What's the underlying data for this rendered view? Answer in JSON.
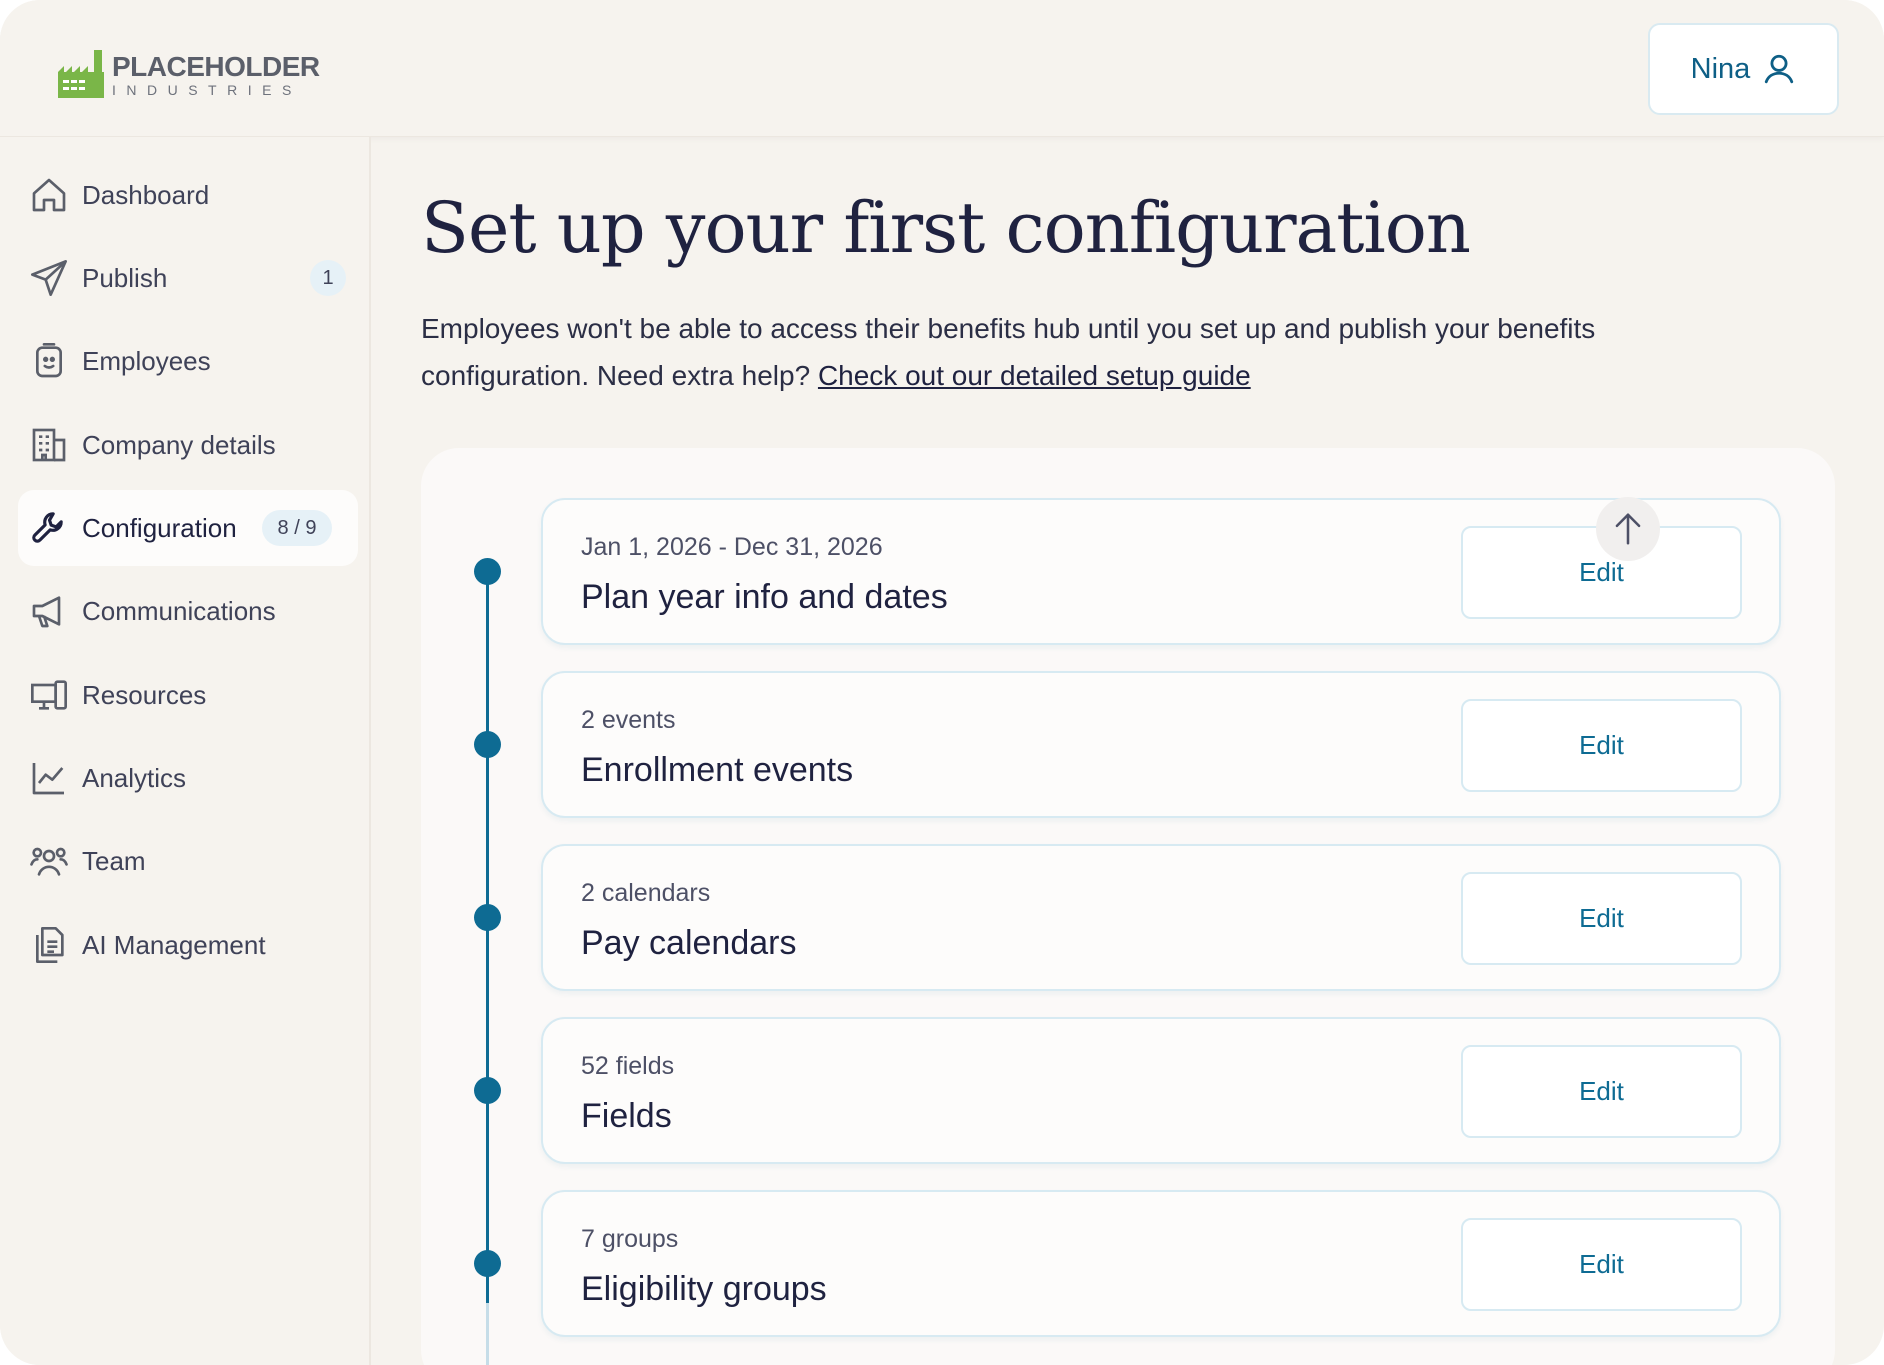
{
  "brand": {
    "name_line1": "PLACEHOLDER",
    "name_line2": "INDUSTRIES",
    "logo_color": "#7ab648"
  },
  "user": {
    "name": "Nina"
  },
  "sidebar": {
    "items": [
      {
        "label": "Dashboard",
        "icon": "home-icon"
      },
      {
        "label": "Publish",
        "icon": "send-icon",
        "badge": "1"
      },
      {
        "label": "Employees",
        "icon": "employee-badge-icon"
      },
      {
        "label": "Company details",
        "icon": "building-icon"
      },
      {
        "label": "Configuration",
        "icon": "wrench-icon",
        "badge": "8 / 9",
        "active": true
      },
      {
        "label": "Communications",
        "icon": "megaphone-icon"
      },
      {
        "label": "Resources",
        "icon": "devices-icon"
      },
      {
        "label": "Analytics",
        "icon": "chart-line-icon"
      },
      {
        "label": "Team",
        "icon": "team-icon"
      },
      {
        "label": "AI Management",
        "icon": "document-icon"
      }
    ]
  },
  "main": {
    "title": "Set up your first configuration",
    "intro": "Employees won't be able to access their benefits hub until you set up and publish your benefits configuration. Need extra help?",
    "guide_link": "Check out our detailed setup guide",
    "steps": [
      {
        "meta": "Jan 1, 2026 - Dec 31, 2026",
        "title": "Plan year info and dates",
        "action": "Edit"
      },
      {
        "meta": "2 events",
        "title": "Enrollment events",
        "action": "Edit"
      },
      {
        "meta": "2 calendars",
        "title": "Pay calendars",
        "action": "Edit"
      },
      {
        "meta": "52 fields",
        "title": "Fields",
        "action": "Edit"
      },
      {
        "meta": "7 groups",
        "title": "Eligibility groups",
        "action": "Edit"
      }
    ]
  },
  "colors": {
    "accent": "#0e6b93",
    "background": "#f6f3ee",
    "text": "#1f2240"
  }
}
